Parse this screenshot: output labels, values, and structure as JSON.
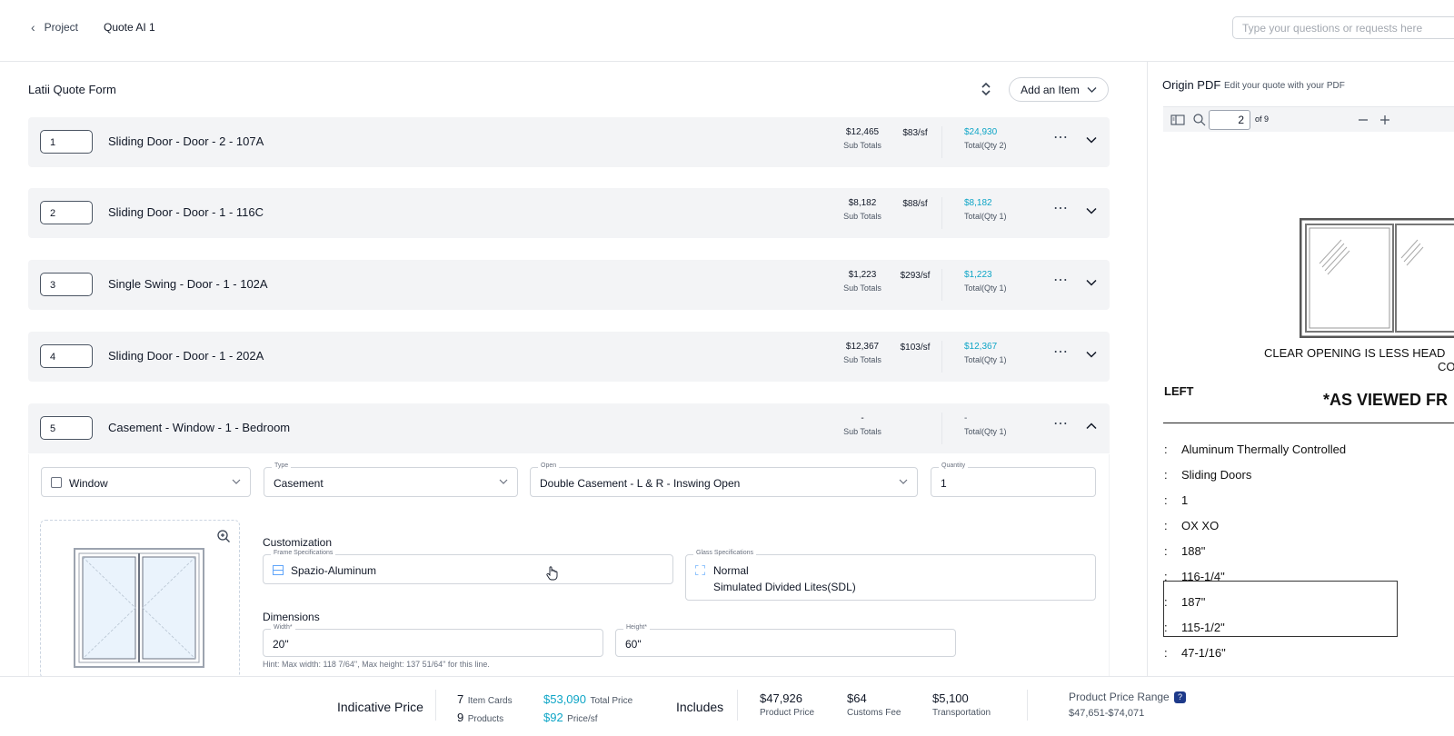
{
  "header": {
    "back_label": "Project",
    "crumb": "Quote AI 1",
    "ask_placeholder": "Type your questions or requests here"
  },
  "form": {
    "title": "Latii Quote Form",
    "add_item_label": "Add an Item"
  },
  "items": [
    {
      "num": "1",
      "name": "Sliding Door - Door - 2 - 107A",
      "sub_total": "$12,465",
      "sub_label": "Sub Totals",
      "per_sf": "$83/sf",
      "total": "$24,930",
      "total_label": "Total(Qty 2)"
    },
    {
      "num": "2",
      "name": "Sliding Door - Door - 1 - 116C",
      "sub_total": "$8,182",
      "sub_label": "Sub Totals",
      "per_sf": "$88/sf",
      "total": "$8,182",
      "total_label": "Total(Qty 1)"
    },
    {
      "num": "3",
      "name": "Single Swing - Door - 1 - 102A",
      "sub_total": "$1,223",
      "sub_label": "Sub Totals",
      "per_sf": "$293/sf",
      "total": "$1,223",
      "total_label": "Total(Qty 1)"
    },
    {
      "num": "4",
      "name": "Sliding Door - Door - 1 - 202A",
      "sub_total": "$12,367",
      "sub_label": "Sub Totals",
      "per_sf": "$103/sf",
      "total": "$12,367",
      "total_label": "Total(Qty 1)"
    },
    {
      "num": "5",
      "name": "Casement - Window - 1 - Bedroom",
      "sub_total": "-",
      "sub_label": "Sub Totals",
      "per_sf": "",
      "total": "-",
      "total_label": "Total(Qty 1)"
    }
  ],
  "expanded": {
    "category": "Window",
    "type_label": "Type",
    "type_value": "Casement",
    "open_label": "Open",
    "open_value": "Double Casement - L & R - Inswing Open",
    "qty_label": "Quantity",
    "qty_value": "1",
    "customization_label": "Customization",
    "frame_label": "Frame Specifications",
    "frame_value": "Spazio-Aluminum",
    "glass_label": "Glass Specifications",
    "glass_value_1": "Normal",
    "glass_value_2": "Simulated Divided Lites(SDL)",
    "dimensions_label": "Dimensions",
    "width_label": "Width*",
    "width_value": "20\"",
    "height_label": "Height*",
    "height_value": "60\"",
    "hint": "Hint: Max width: 118 7/64\", Max height: 137 51/64\" for this line."
  },
  "pdf": {
    "title": "Origin PDF",
    "subtitle": "Edit your quote with your PDF",
    "page": "2",
    "of_label": "of 9",
    "doc": {
      "clear_opening": "CLEAR OPENING IS LESS HEAD",
      "clear_opening_2": "CON",
      "left": "LEFT",
      "viewed": "*AS VIEWED FR",
      "rows": [
        {
          "sep": ":",
          "text": "Aluminum Thermally Controlled"
        },
        {
          "sep": ":",
          "text": "Sliding Doors"
        },
        {
          "sep": ":",
          "text": "1"
        },
        {
          "sep": ":",
          "text": "OX XO"
        },
        {
          "sep": ":",
          "text": "188\""
        },
        {
          "sep": ":",
          "text": "116-1/4\""
        },
        {
          "sep": ":",
          "text": "187\""
        },
        {
          "sep": ":",
          "text": "115-1/2\""
        },
        {
          "sep": ":",
          "text": "47-1/16\""
        }
      ]
    }
  },
  "footer": {
    "indicative_label": "Indicative Price",
    "item_cards_num": "7",
    "item_cards_label": "Item Cards",
    "products_num": "9",
    "products_label": "Products",
    "total_price": "$53,090",
    "total_price_label": "Total Price",
    "price_sf": "$92",
    "price_sf_label": "Price/sf",
    "includes_label": "Includes",
    "product_price": "$47,926",
    "product_price_label": "Product Price",
    "customs_fee": "$64",
    "customs_fee_label": "Customs Fee",
    "transportation": "$5,100",
    "transportation_label": "Transportation",
    "range_label": "Product Price Range",
    "range_value": "$47,651-$74,071",
    "help_glyph": "?"
  },
  "colors": {
    "accent": "#0ea5c6",
    "row_bg": "#f3f4f6"
  }
}
